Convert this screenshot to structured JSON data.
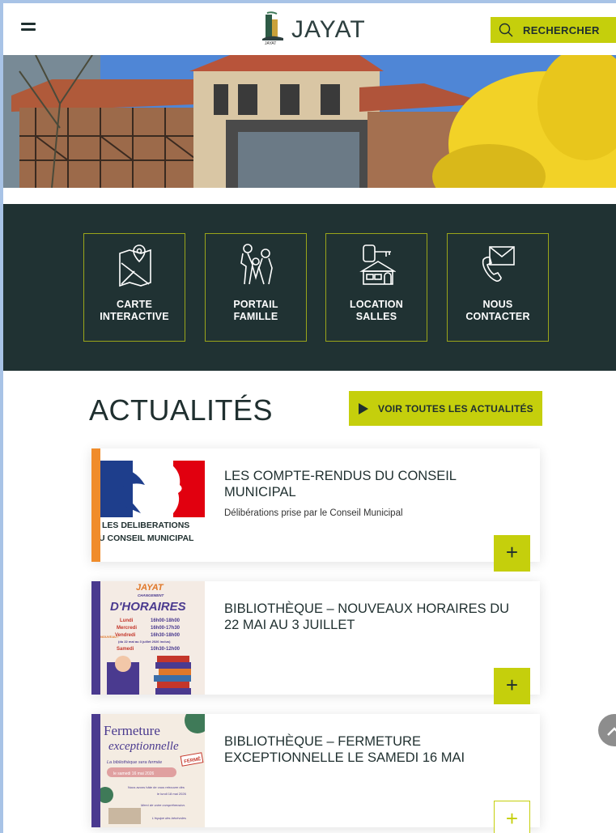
{
  "header": {
    "logo_text": "JAYAT",
    "logo_small": "JAYAT",
    "search_label": "RECHERCHER"
  },
  "quick_links": [
    {
      "line1": "CARTE",
      "line2": "INTERACTIVE",
      "icon": "map-pin-icon"
    },
    {
      "line1": "PORTAIL",
      "line2": "FAMILLE",
      "icon": "family-icon"
    },
    {
      "line1": "LOCATION",
      "line2": "SALLES",
      "icon": "building-key-icon"
    },
    {
      "line1": "NOUS",
      "line2": "CONTACTER",
      "icon": "phone-mail-icon"
    }
  ],
  "news": {
    "title": "ACTUALITÉS",
    "see_all_label": "VOIR TOUTES LES ACTUALITÉS",
    "items": [
      {
        "title": "LES COMPTE-RENDUS DU CONSEIL MUNICIPAL",
        "subtitle": "Délibérations prise par le Conseil Municipal",
        "thumb_line1": "LES DELIBERATIONS",
        "thumb_line2": "U CONSEIL MUNICIPAL",
        "bar_color": "#f08c2b",
        "more_label": "+"
      },
      {
        "title": "BIBLIOTHÈQUE – NOUVEAUX HORAIRES DU 22 MAI AU 3 JUILLET",
        "subtitle": "",
        "thumb_heading": "JAYAT",
        "thumb_sub": "CHANGEMENT",
        "thumb_big": "D'HORAIRES",
        "thumb_rows": [
          {
            "day": "Lundi",
            "hours": "16h00-18h00"
          },
          {
            "day": "Mercredi",
            "hours": "16h00-17h30"
          },
          {
            "day": "Vendredi",
            "hours": "16h30-18h00"
          },
          {
            "day": "Samedi",
            "hours": "10h30-12h00"
          }
        ],
        "thumb_note": "(du 22 mai au 3 juillet 2026 inclus)",
        "thumb_side": "NOUVEAU !",
        "bar_color": "#4a3a8f",
        "more_label": "+"
      },
      {
        "title": "BIBLIOTHÈQUE – FERMETURE EXCEPTIONNELLE LE SAMEDI 16 MAI",
        "subtitle": "",
        "thumb_line1": "Fermeture",
        "thumb_line2": "exceptionnelle",
        "thumb_line3": "La bibliothèque sera fermée",
        "thumb_stamp": "FERMÉ",
        "thumb_date": "le samedi 16 mai 2026",
        "thumb_line4": "Nous avons hâte de vous retrouver dès",
        "thumb_line5": "le lundi 18 mai 2026",
        "thumb_line6": "Merci de votre compréhension.",
        "thumb_line7": "L'équipe des bénévoles",
        "bar_color": "#4a3a8f",
        "more_label": "+"
      }
    ]
  },
  "colors": {
    "accent": "#c5cf0c",
    "dark": "#203233",
    "text": "#1f2f2f"
  }
}
